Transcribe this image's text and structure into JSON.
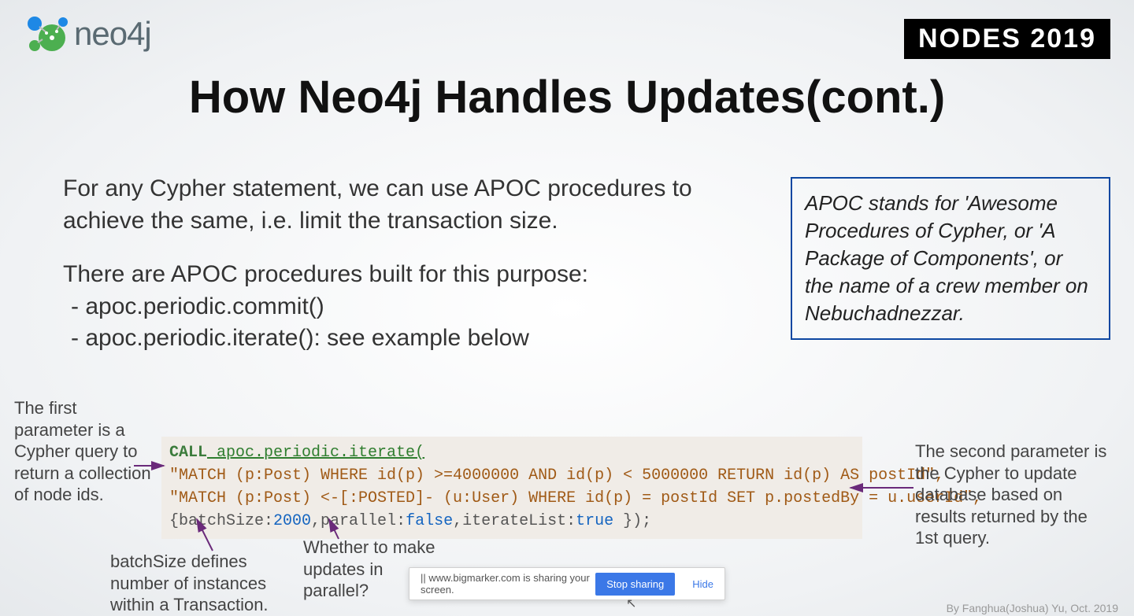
{
  "header": {
    "logo_text": "neo4j",
    "event_badge": "NODES 2019"
  },
  "title": "How Neo4j Handles Updates(cont.)",
  "body": {
    "para1": "For any Cypher statement, we can use APOC procedures to achieve the same, i.e. limit the transaction size.",
    "para2": "There are APOC procedures built for this purpose:",
    "bullet1": "-   apoc.periodic.commit()",
    "bullet2": "-   apoc.periodic.iterate(): see example below"
  },
  "apoc_box": "APOC stands for 'Awesome Procedures of Cypher, or 'A Package of Components', or the name of a crew member on Nebuchadnezzar.",
  "code": {
    "call_kw": "CALL",
    "fn_name": " apoc.periodic.iterate(",
    "line2": "\"MATCH (p:Post) WHERE id(p) >=4000000 AND id(p) < 5000000 RETURN id(p) AS postId\",",
    "line3": "\"MATCH (p:Post) <-[:POSTED]- (u:User) WHERE id(p) = postId SET p.postedBy = u.userId\",",
    "opt_open": "{batchSize:",
    "batch_val": "2000",
    "opt_mid1": ",parallel:",
    "parallel_val": "false",
    "opt_mid2": ",iterateList:",
    "iter_val": "true",
    "opt_close": " });"
  },
  "annotations": {
    "left": "The first parameter is a Cypher query to return a collection of node ids.",
    "right": "The second parameter is the Cypher to update database based on results returned by the 1st query.",
    "batch": "batchSize defines number of instances within a Transaction.",
    "parallel": "Whether to make updates in parallel?"
  },
  "share_bar": {
    "message": "||  www.bigmarker.com is sharing your screen.",
    "stop": "Stop sharing",
    "hide": "Hide"
  },
  "footer_credit": "By Fanghua(Joshua) Yu, Oct. 2019"
}
